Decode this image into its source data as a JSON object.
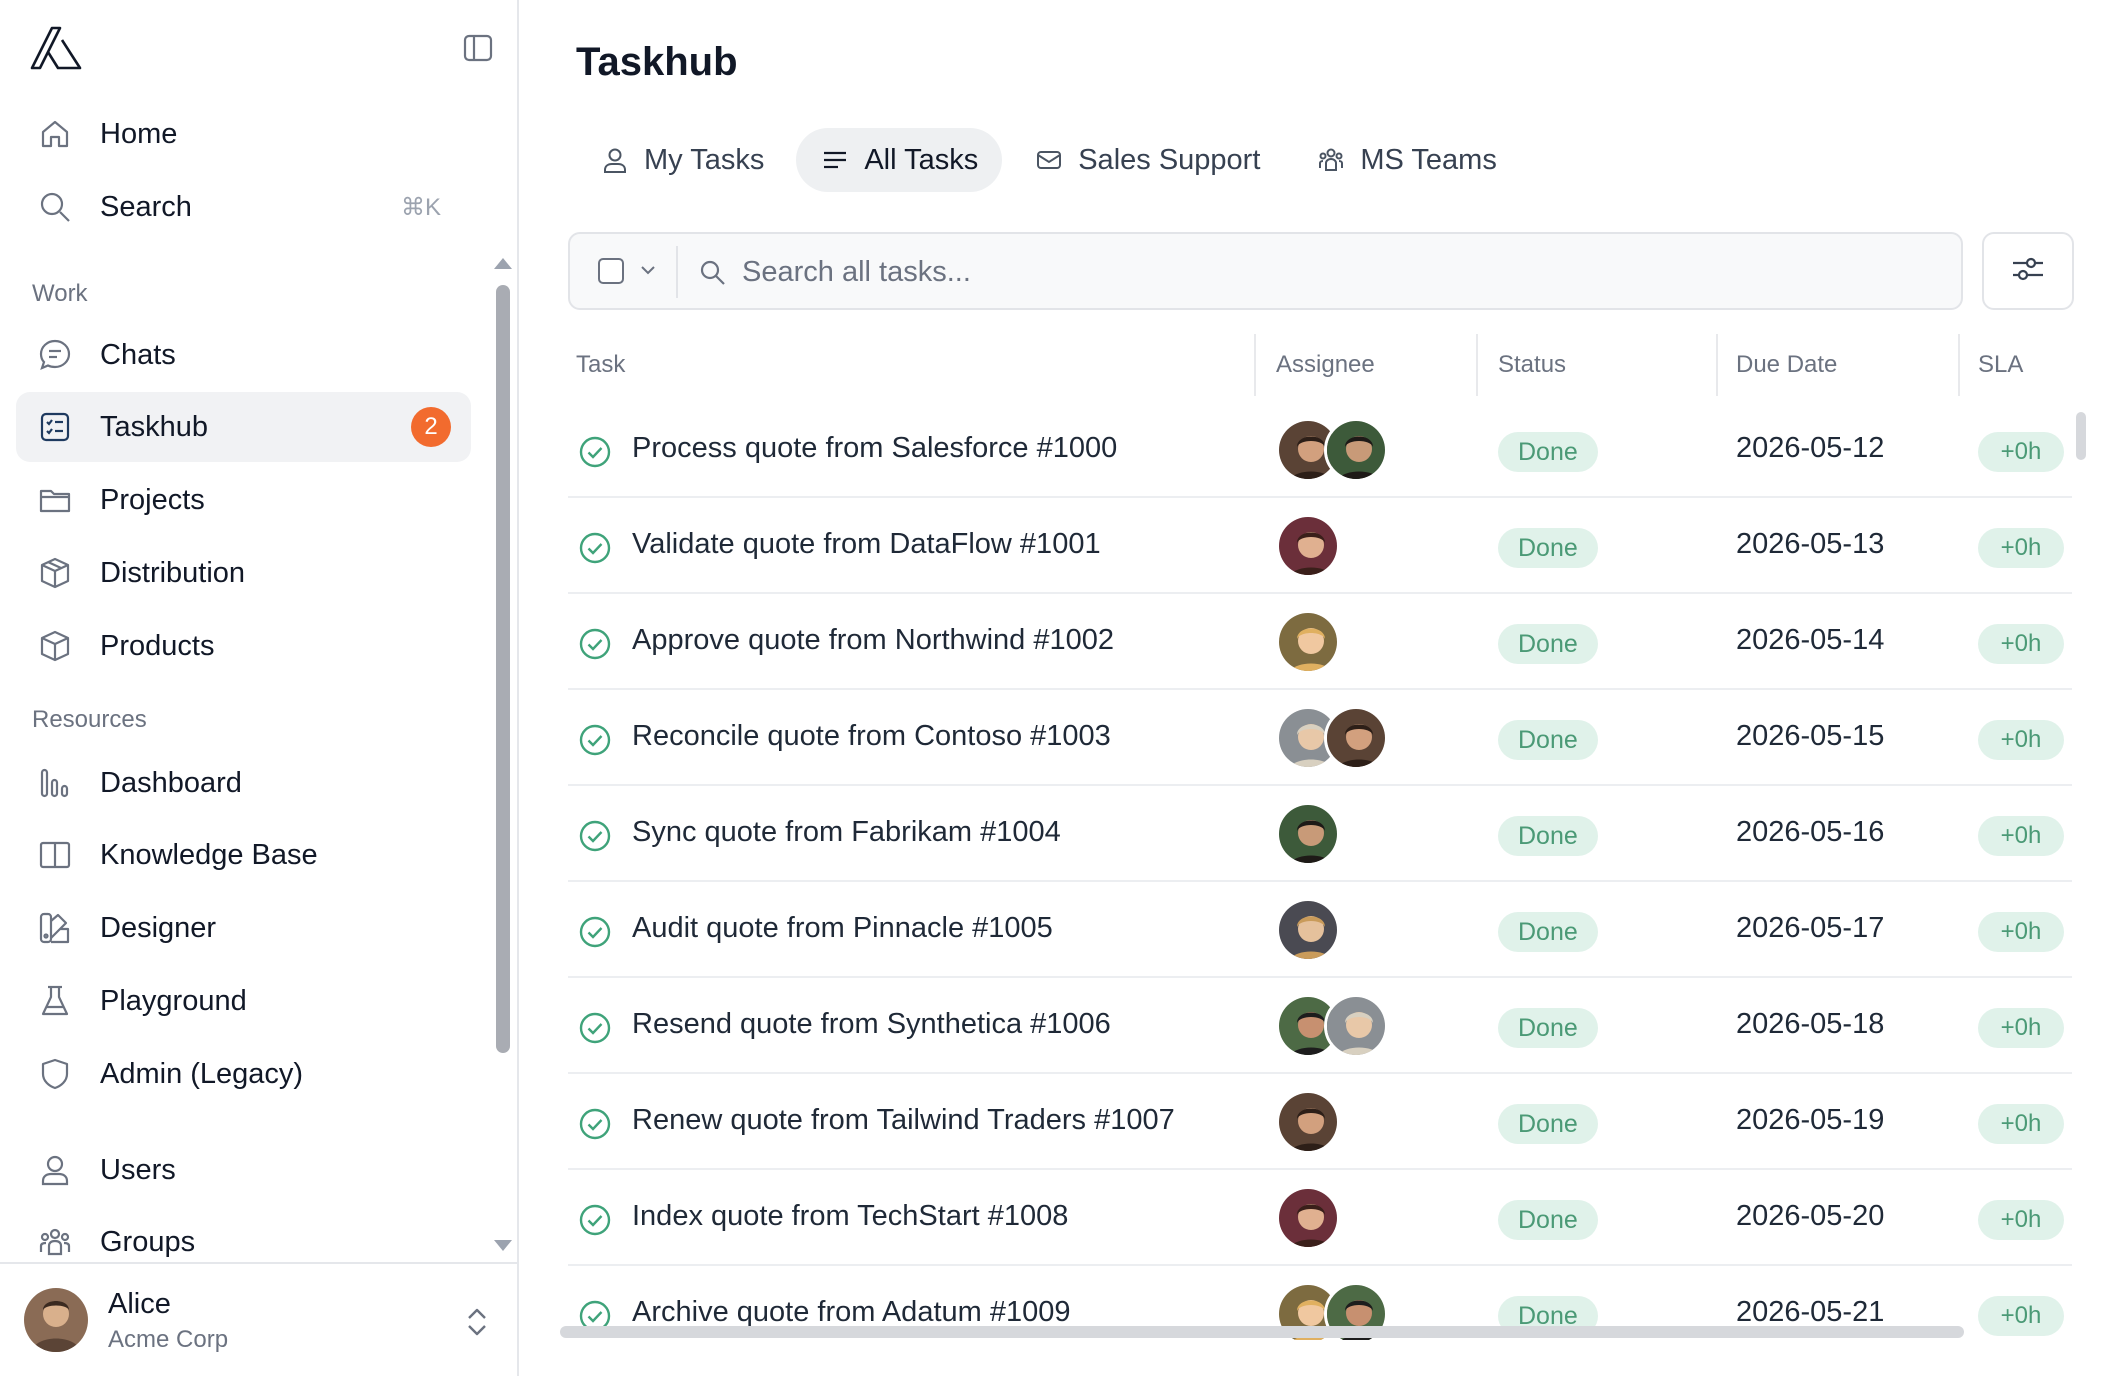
{
  "sidebar": {
    "nav_top": [
      {
        "label": "Home",
        "icon": "home-icon"
      },
      {
        "label": "Search",
        "icon": "search-icon",
        "shortcut": "⌘K"
      }
    ],
    "work_label": "Work",
    "work_items": [
      {
        "label": "Chats",
        "icon": "chat-icon"
      },
      {
        "label": "Taskhub",
        "icon": "checklist-icon",
        "badge": "2",
        "active": true
      },
      {
        "label": "Projects",
        "icon": "folder-icon"
      },
      {
        "label": "Distribution",
        "icon": "package-icon"
      },
      {
        "label": "Products",
        "icon": "box-icon"
      }
    ],
    "resources_label": "Resources",
    "resource_items": [
      {
        "label": "Dashboard",
        "icon": "bar-chart-icon"
      },
      {
        "label": "Knowledge Base",
        "icon": "book-icon"
      },
      {
        "label": "Designer",
        "icon": "designer-icon"
      },
      {
        "label": "Playground",
        "icon": "flask-icon"
      },
      {
        "label": "Admin (Legacy)",
        "icon": "shield-icon"
      }
    ],
    "admin_items": [
      {
        "label": "Users",
        "icon": "user-icon"
      },
      {
        "label": "Groups",
        "icon": "groups-icon"
      }
    ],
    "user": {
      "name": "Alice",
      "org": "Acme Corp"
    }
  },
  "main": {
    "title": "Taskhub",
    "tabs": [
      {
        "label": "My Tasks",
        "icon": "user-icon"
      },
      {
        "label": "All Tasks",
        "icon": "list-icon",
        "active": true
      },
      {
        "label": "Sales Support",
        "icon": "mail-icon"
      },
      {
        "label": "MS Teams",
        "icon": "groups-icon"
      }
    ],
    "search": {
      "placeholder": "Search all tasks..."
    },
    "table": {
      "columns": [
        "Task",
        "Assignee",
        "Status",
        "Due Date",
        "SLA"
      ],
      "rows": [
        {
          "task": "Process quote from Salesforce #1000",
          "status": "Done",
          "due": "2026-05-12",
          "sla": "+0h",
          "assignees": 2
        },
        {
          "task": "Validate quote from DataFlow #1001",
          "status": "Done",
          "due": "2026-05-13",
          "sla": "+0h",
          "assignees": 1
        },
        {
          "task": "Approve quote from Northwind #1002",
          "status": "Done",
          "due": "2026-05-14",
          "sla": "+0h",
          "assignees": 1
        },
        {
          "task": "Reconcile quote from Contoso #1003",
          "status": "Done",
          "due": "2026-05-15",
          "sla": "+0h",
          "assignees": 2
        },
        {
          "task": "Sync quote from Fabrikam #1004",
          "status": "Done",
          "due": "2026-05-16",
          "sla": "+0h",
          "assignees": 1
        },
        {
          "task": "Audit quote from Pinnacle #1005",
          "status": "Done",
          "due": "2026-05-17",
          "sla": "+0h",
          "assignees": 1
        },
        {
          "task": "Resend quote from Synthetica #1006",
          "status": "Done",
          "due": "2026-05-18",
          "sla": "+0h",
          "assignees": 2
        },
        {
          "task": "Renew quote from Tailwind Traders #1007",
          "status": "Done",
          "due": "2026-05-19",
          "sla": "+0h",
          "assignees": 1
        },
        {
          "task": "Index quote from TechStart #1008",
          "status": "Done",
          "due": "2026-05-20",
          "sla": "+0h",
          "assignees": 1
        },
        {
          "task": "Archive quote from Adatum #1009",
          "status": "Done",
          "due": "2026-05-21",
          "sla": "+0h",
          "assignees": 2
        }
      ]
    }
  },
  "colors": {
    "badge": "#f26b2e",
    "done_bg": "#e0f2ea",
    "done_text": "#4b9a76",
    "check": "#3fa37a"
  }
}
